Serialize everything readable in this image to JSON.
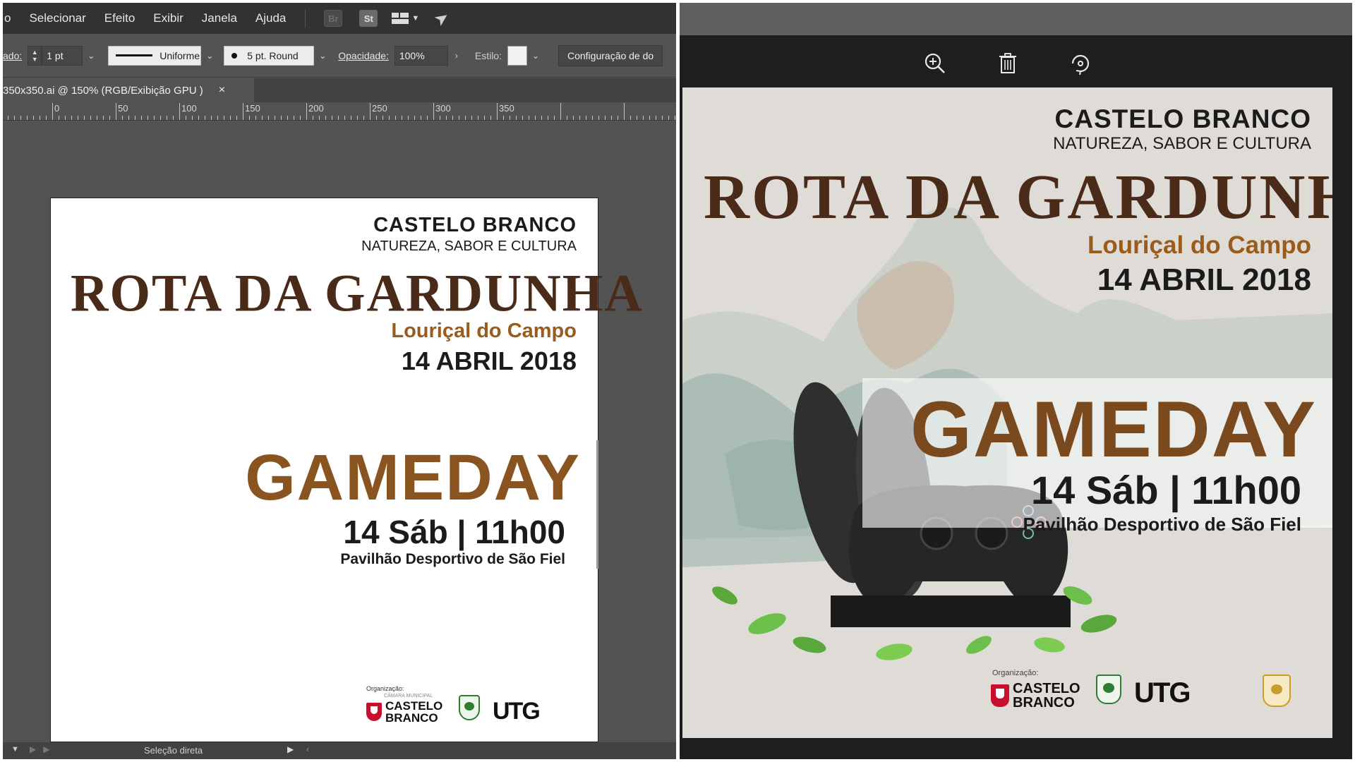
{
  "illustrator": {
    "menu": [
      "o",
      "Selecionar",
      "Efeito",
      "Exibir",
      "Janela",
      "Ajuda"
    ],
    "menu_icons": {
      "bridge": "Br",
      "stock": "St"
    },
    "control_bar": {
      "stroke_label": "ado:",
      "stroke_weight": "1 pt",
      "profile": "Uniforme",
      "brush": "5 pt. Round",
      "opacity_label": "Opacidade:",
      "opacity_value": "100%",
      "style_label": "Estilo:",
      "doc_setup_button": "Configuração de do"
    },
    "document_tab": {
      "title": "350x350.ai @ 150% (RGB/Exibição GPU )",
      "close": "×"
    },
    "ruler_labels": [
      "0",
      "50",
      "100",
      "150",
      "200",
      "250",
      "300",
      "350"
    ],
    "status_bar": {
      "tool": "Seleção direta"
    }
  },
  "poster": {
    "city": "CASTELO BRANCO",
    "tagline": "NATUREZA, SABOR E CULTURA",
    "route": "ROTA DA GARDUNHA",
    "place": "Louriçal do Campo",
    "date": "14 ABRIL 2018",
    "event": "GAMEDAY",
    "time": "14 Sáb | 11h00",
    "venue": "Pavilhão Desportivo de São Fiel",
    "org_left": "Organização:",
    "org_right": "Organização:",
    "council_small": "CÂMARA MUNICIPAL",
    "logo_castelo": "CASTELO",
    "logo_branco": "BRANCO",
    "logo_utg": "UTG"
  },
  "photo_viewer": {
    "toolbar_icons": [
      "zoom-in-icon",
      "trash-icon",
      "rotate-icon"
    ]
  },
  "colors": {
    "route_brown": "#4a2a19",
    "place_orange": "#9a5c1c",
    "gameday_brown": "#8a5421",
    "logo_red": "#c8102e",
    "illustrator_bg": "#535353",
    "menubar_bg": "#323232"
  }
}
